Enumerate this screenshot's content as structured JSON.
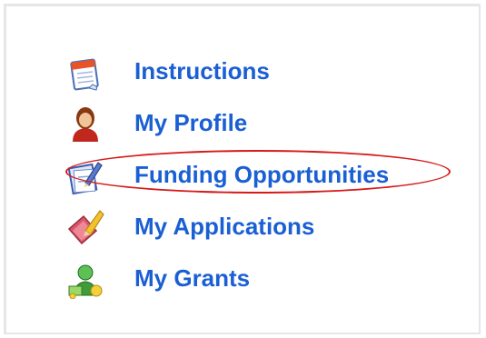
{
  "menu": {
    "items": [
      {
        "label": "Instructions",
        "icon": "calendar-pad-icon"
      },
      {
        "label": "My Profile",
        "icon": "person-icon"
      },
      {
        "label": "Funding Opportunities",
        "icon": "document-pencil-icon"
      },
      {
        "label": "My Applications",
        "icon": "pencil-eraser-icon"
      },
      {
        "label": "My Grants",
        "icon": "money-person-icon"
      }
    ],
    "highlighted_item": "Funding Opportunities"
  },
  "colors": {
    "link": "#1a5fd3",
    "highlight": "#d61a1a",
    "frame_border": "#e6e6e6"
  }
}
